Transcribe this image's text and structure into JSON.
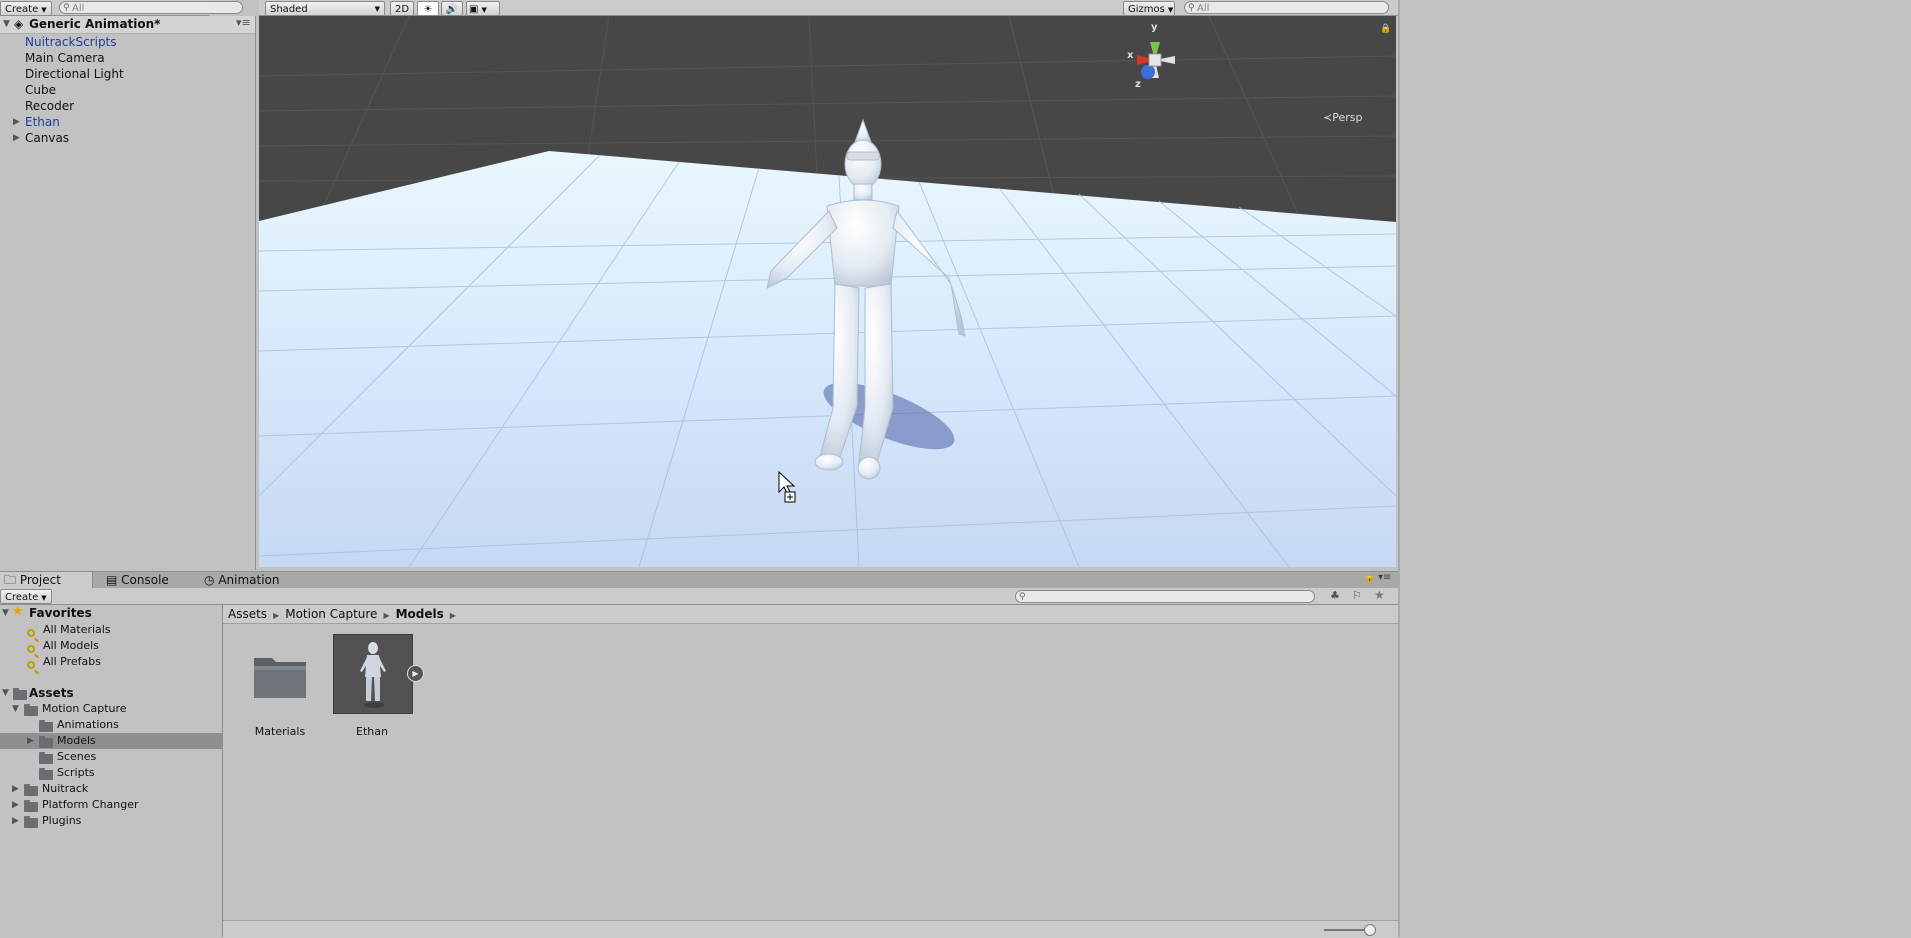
{
  "hierarchy": {
    "create_label": "Create",
    "search_placeholder": "All",
    "scene_name": "Generic Animation*",
    "items": [
      {
        "label": "NuitrackScripts",
        "prefab": true,
        "expandable": false
      },
      {
        "label": "Main Camera",
        "prefab": false,
        "expandable": false
      },
      {
        "label": "Directional Light",
        "prefab": false,
        "expandable": false
      },
      {
        "label": "Cube",
        "prefab": false,
        "expandable": false
      },
      {
        "label": "Recoder",
        "prefab": false,
        "expandable": false
      },
      {
        "label": "Ethan",
        "prefab": true,
        "expandable": true
      },
      {
        "label": "Canvas",
        "prefab": false,
        "expandable": true
      }
    ]
  },
  "scene_toolbar": {
    "shading_mode": "Shaded",
    "mode_2d": "2D",
    "gizmos_label": "Gizmos",
    "search_placeholder": "All"
  },
  "scene_view": {
    "gizmo_y": "y",
    "gizmo_x": "x",
    "gizmo_z": "z",
    "projection_label": "Persp"
  },
  "bottom_tabs": {
    "project": "Project",
    "console": "Console",
    "animation": "Animation"
  },
  "project": {
    "create_label": "Create",
    "favorites_label": "Favorites",
    "favorites": [
      "All Materials",
      "All Models",
      "All Prefabs"
    ],
    "assets_label": "Assets",
    "tree": [
      {
        "label": "Motion Capture",
        "indent": 1,
        "expanded": true,
        "expandable": true,
        "selected": false
      },
      {
        "label": "Animations",
        "indent": 2,
        "expanded": false,
        "expandable": false,
        "selected": false
      },
      {
        "label": "Models",
        "indent": 2,
        "expanded": false,
        "expandable": true,
        "selected": true
      },
      {
        "label": "Scenes",
        "indent": 2,
        "expanded": false,
        "expandable": false,
        "selected": false
      },
      {
        "label": "Scripts",
        "indent": 2,
        "expanded": false,
        "expandable": false,
        "selected": false
      },
      {
        "label": "Nuitrack",
        "indent": 1,
        "expanded": false,
        "expandable": true,
        "selected": false
      },
      {
        "label": "Platform Changer",
        "indent": 1,
        "expanded": false,
        "expandable": true,
        "selected": false
      },
      {
        "label": "Plugins",
        "indent": 1,
        "expanded": false,
        "expandable": true,
        "selected": false
      }
    ],
    "breadcrumb": [
      "Assets",
      "Motion Capture",
      "Models"
    ],
    "grid_items": [
      {
        "label": "Materials",
        "kind": "folder"
      },
      {
        "label": "Ethan",
        "kind": "model"
      }
    ]
  },
  "colors": {
    "selection": "#8f8f8f",
    "prefab_text": "#1f3e9c",
    "sky": "#474747",
    "floor": "#cfe2f8"
  }
}
